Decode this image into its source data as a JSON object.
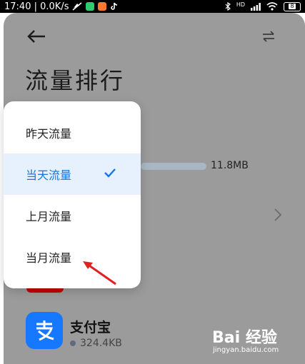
{
  "status_bar": {
    "time_speed": "17:40 | 0.0K/s",
    "battery": "8",
    "network": "HD"
  },
  "header": {
    "title": "流量排行"
  },
  "dropdown": {
    "items": [
      {
        "label": "昨天流量",
        "selected": false
      },
      {
        "label": "当天流量",
        "selected": true
      },
      {
        "label": "上月流量",
        "selected": false
      },
      {
        "label": "当月流量",
        "selected": false
      }
    ]
  },
  "usage_item": {
    "value": "11.8MB"
  },
  "apps": [
    {
      "name": "支付宝",
      "usage": "324.4KB",
      "icon": "alipay-icon"
    }
  ],
  "watermark": {
    "logo": "Bai 经验",
    "url": "jingyan.baidu.com"
  },
  "colors": {
    "accent": "#1276e8",
    "selected_bg": "#e6f1fd",
    "overlay": "#9b9b9b",
    "annotation": "#e02020"
  }
}
